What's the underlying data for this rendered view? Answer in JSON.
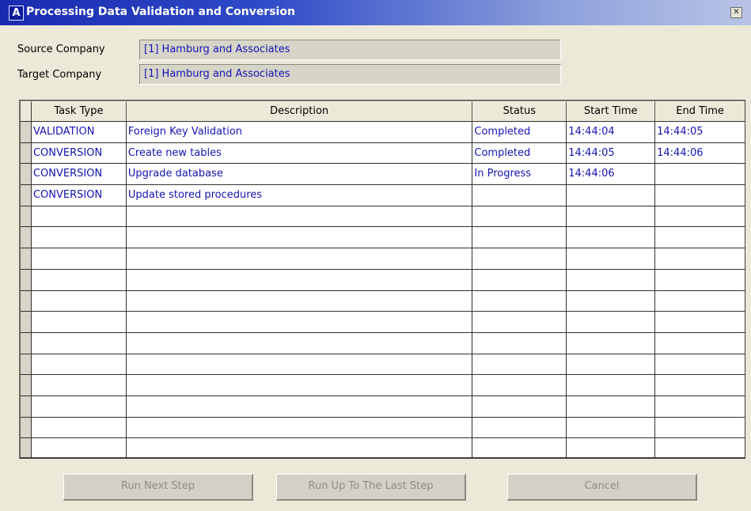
{
  "window": {
    "title": "Processing Data Validation and Conversion",
    "icon_letter": "A",
    "close_glyph": "✕"
  },
  "form": {
    "source_label": "Source Company",
    "source_value": "[1] Hamburg and Associates",
    "target_label": "Target Company",
    "target_value": "[1] Hamburg and Associates"
  },
  "grid": {
    "columns": [
      "Task Type",
      "Description",
      "Status",
      "Start Time",
      "End Time"
    ],
    "rows": [
      {
        "task_type": "VALIDATION",
        "description": "Foreign Key Validation",
        "status": "Completed",
        "start": "14:44:04",
        "end": "14:44:05"
      },
      {
        "task_type": "CONVERSION",
        "description": "Create new tables",
        "status": "Completed",
        "start": "14:44:05",
        "end": "14:44:06"
      },
      {
        "task_type": "CONVERSION",
        "description": "Upgrade database",
        "status": "In Progress",
        "start": "14:44:06",
        "end": ""
      },
      {
        "task_type": "CONVERSION",
        "description": "Update stored procedures",
        "status": "",
        "start": "",
        "end": ""
      },
      {
        "task_type": "",
        "description": "",
        "status": "",
        "start": "",
        "end": ""
      },
      {
        "task_type": "",
        "description": "",
        "status": "",
        "start": "",
        "end": ""
      },
      {
        "task_type": "",
        "description": "",
        "status": "",
        "start": "",
        "end": ""
      },
      {
        "task_type": "",
        "description": "",
        "status": "",
        "start": "",
        "end": ""
      },
      {
        "task_type": "",
        "description": "",
        "status": "",
        "start": "",
        "end": ""
      },
      {
        "task_type": "",
        "description": "",
        "status": "",
        "start": "",
        "end": ""
      },
      {
        "task_type": "",
        "description": "",
        "status": "",
        "start": "",
        "end": ""
      },
      {
        "task_type": "",
        "description": "",
        "status": "",
        "start": "",
        "end": ""
      },
      {
        "task_type": "",
        "description": "",
        "status": "",
        "start": "",
        "end": ""
      },
      {
        "task_type": "",
        "description": "",
        "status": "",
        "start": "",
        "end": ""
      },
      {
        "task_type": "",
        "description": "",
        "status": "",
        "start": "",
        "end": ""
      },
      {
        "task_type": "",
        "description": "",
        "status": "",
        "start": "",
        "end": ""
      }
    ]
  },
  "buttons": {
    "run_next": "Run Next Step",
    "run_to_last": "Run Up To The Last Step",
    "cancel": "Cancel"
  },
  "colors": {
    "title_gradient_start": "#1a2ab0",
    "value_text": "#1414b4",
    "window_bg": "#ece9d8"
  }
}
